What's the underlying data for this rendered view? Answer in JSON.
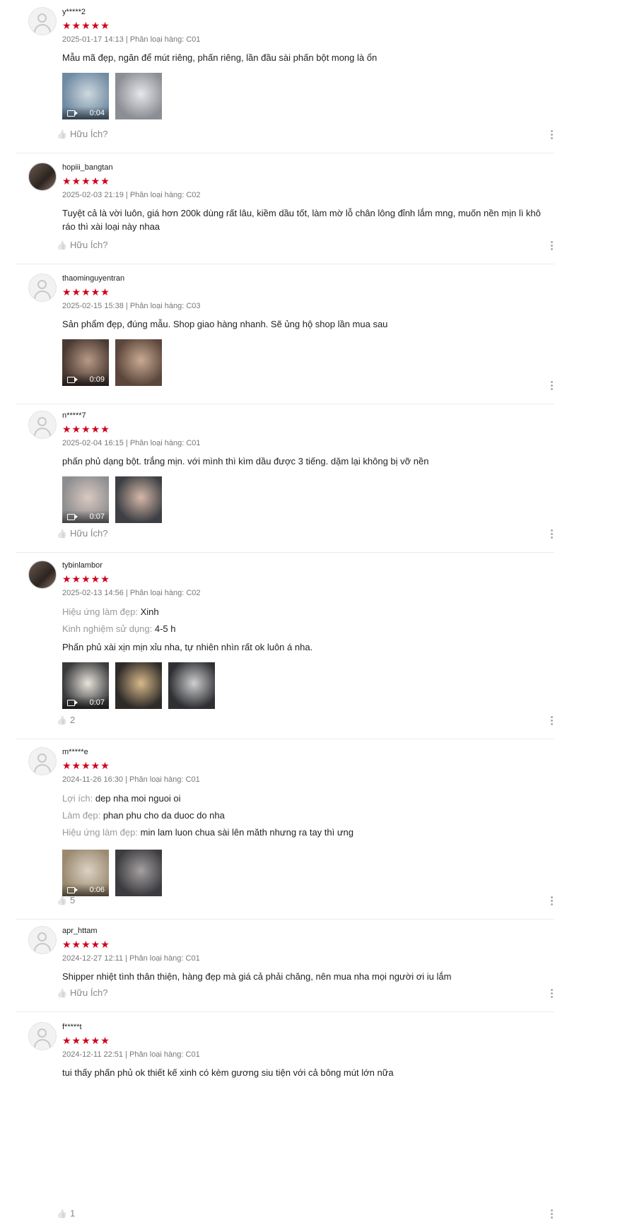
{
  "reviews": [
    {
      "user": "y*****2",
      "stars": "★★★★★",
      "meta": "2025-01-17 14:13 | Phân loại hàng: C01",
      "attrs": [],
      "body": "Mẫu mã đẹp, ngăn để mút riêng, phấn riêng, lần đầu sài phấn bột mong là ổn",
      "media": [
        {
          "duration": "0:04",
          "colors": [
            "#6f8ba3",
            "#cfd8de"
          ]
        },
        {
          "duration": "",
          "colors": [
            "#8b8e94",
            "#e6e7ea"
          ]
        }
      ],
      "helpful": "Hữu Ích?"
    },
    {
      "user": "hopiii_bangtan",
      "stars": "★★★★★",
      "meta": "2025-02-03 21:19 | Phân loại hàng: C02",
      "attrs": [],
      "body": "Tuyệt cả là vời luôn, giá hơn 200k dùng rất lâu, kiềm dầu tốt, làm mờ lỗ chân lông đỉnh lắm mng, muốn nền mịn lì khô ráo thì xài loại này nhaa",
      "media": [],
      "helpful": "Hữu Ích?"
    },
    {
      "user": "thaominguyentran",
      "stars": "★★★★★",
      "meta": "2025-02-15 15:38 | Phân loại hàng: C03",
      "attrs": [],
      "body": "Sản phẩm đẹp, đúng mẫu. Shop giao hàng nhanh. Sẽ ủng hộ shop lần mua sau",
      "media": [
        {
          "duration": "0:09",
          "colors": [
            "#4a3a32",
            "#b89a86"
          ]
        },
        {
          "duration": "",
          "colors": [
            "#5b463b",
            "#c9ab93"
          ]
        }
      ],
      "helpful": ""
    },
    {
      "user": "n*****7",
      "stars": "★★★★★",
      "meta": "2025-02-04 16:15 | Phân loại hàng: C01",
      "attrs": [],
      "body": "phấn phủ dạng bột. trắng mịn. với mình thì kìm dầu được 3 tiếng. dặm lại không bị vỡ nền",
      "media": [
        {
          "duration": "0:07",
          "colors": [
            "#8e8e90",
            "#d9c9c0"
          ]
        },
        {
          "duration": "",
          "colors": [
            "#3d3f44",
            "#d6b9a8"
          ]
        }
      ],
      "helpful": "Hữu Ích?"
    },
    {
      "user": "tybinlambor",
      "stars": "★★★★★",
      "meta": "2025-02-13 14:56 | Phân loại hàng: C02",
      "attrs": [
        {
          "key": "Hiệu ứng làm đẹp:",
          "value": "Xinh"
        },
        {
          "key": "Kinh nghiệm sử dụng:",
          "value": "4-5 h"
        }
      ],
      "body": "Phấn phủ xài xịn mịn xỉu nha, tự nhiên nhìn rất ok luôn á nha.",
      "media": [
        {
          "duration": "0:07",
          "colors": [
            "#3a3a3c",
            "#e8e4dc"
          ]
        },
        {
          "duration": "",
          "colors": [
            "#2d2a28",
            "#d9b98a"
          ]
        },
        {
          "duration": "",
          "colors": [
            "#2f3033",
            "#cfcfd1"
          ]
        }
      ],
      "helpful": "2"
    },
    {
      "user": "m*****e",
      "stars": "★★★★★",
      "meta": "2024-11-26 16:30 | Phân loại hàng: C01",
      "attrs": [
        {
          "key": "Lợi ích:",
          "value": "dep nha moi nguoi oi"
        },
        {
          "key": "Làm đẹp:",
          "value": "phan phu cho da duoc do nha"
        },
        {
          "key": "Hiệu ứng làm đẹp:",
          "value": "min lam luon chua sài lên măth nhưng ra tay thì ưng"
        }
      ],
      "body": "",
      "media": [
        {
          "duration": "0:06",
          "colors": [
            "#9b8a70",
            "#dcd3c4"
          ]
        },
        {
          "duration": "",
          "colors": [
            "#3c3c40",
            "#a5a0a0"
          ]
        }
      ],
      "helpful": "5"
    },
    {
      "user": "apr_httam",
      "stars": "★★★★★",
      "meta": "2024-12-27 12:11 | Phân loại hàng: C01",
      "attrs": [],
      "body": "Shipper nhiệt tình thân thiện, hàng đẹp mà giá cả phải chăng, nên mua nha mọi người ơi iu lắm",
      "media": [],
      "helpful": "Hữu Ích?"
    },
    {
      "user": "f*****t",
      "stars": "★★★★★",
      "meta": "2024-12-11 22:51 | Phân loại hàng: C01",
      "attrs": [],
      "body": "tui thấy phấn phủ ok thiết kế xinh có kèm gương siu tiện với cả bông mút lớn nữa",
      "media": [],
      "helpful": "1"
    }
  ]
}
